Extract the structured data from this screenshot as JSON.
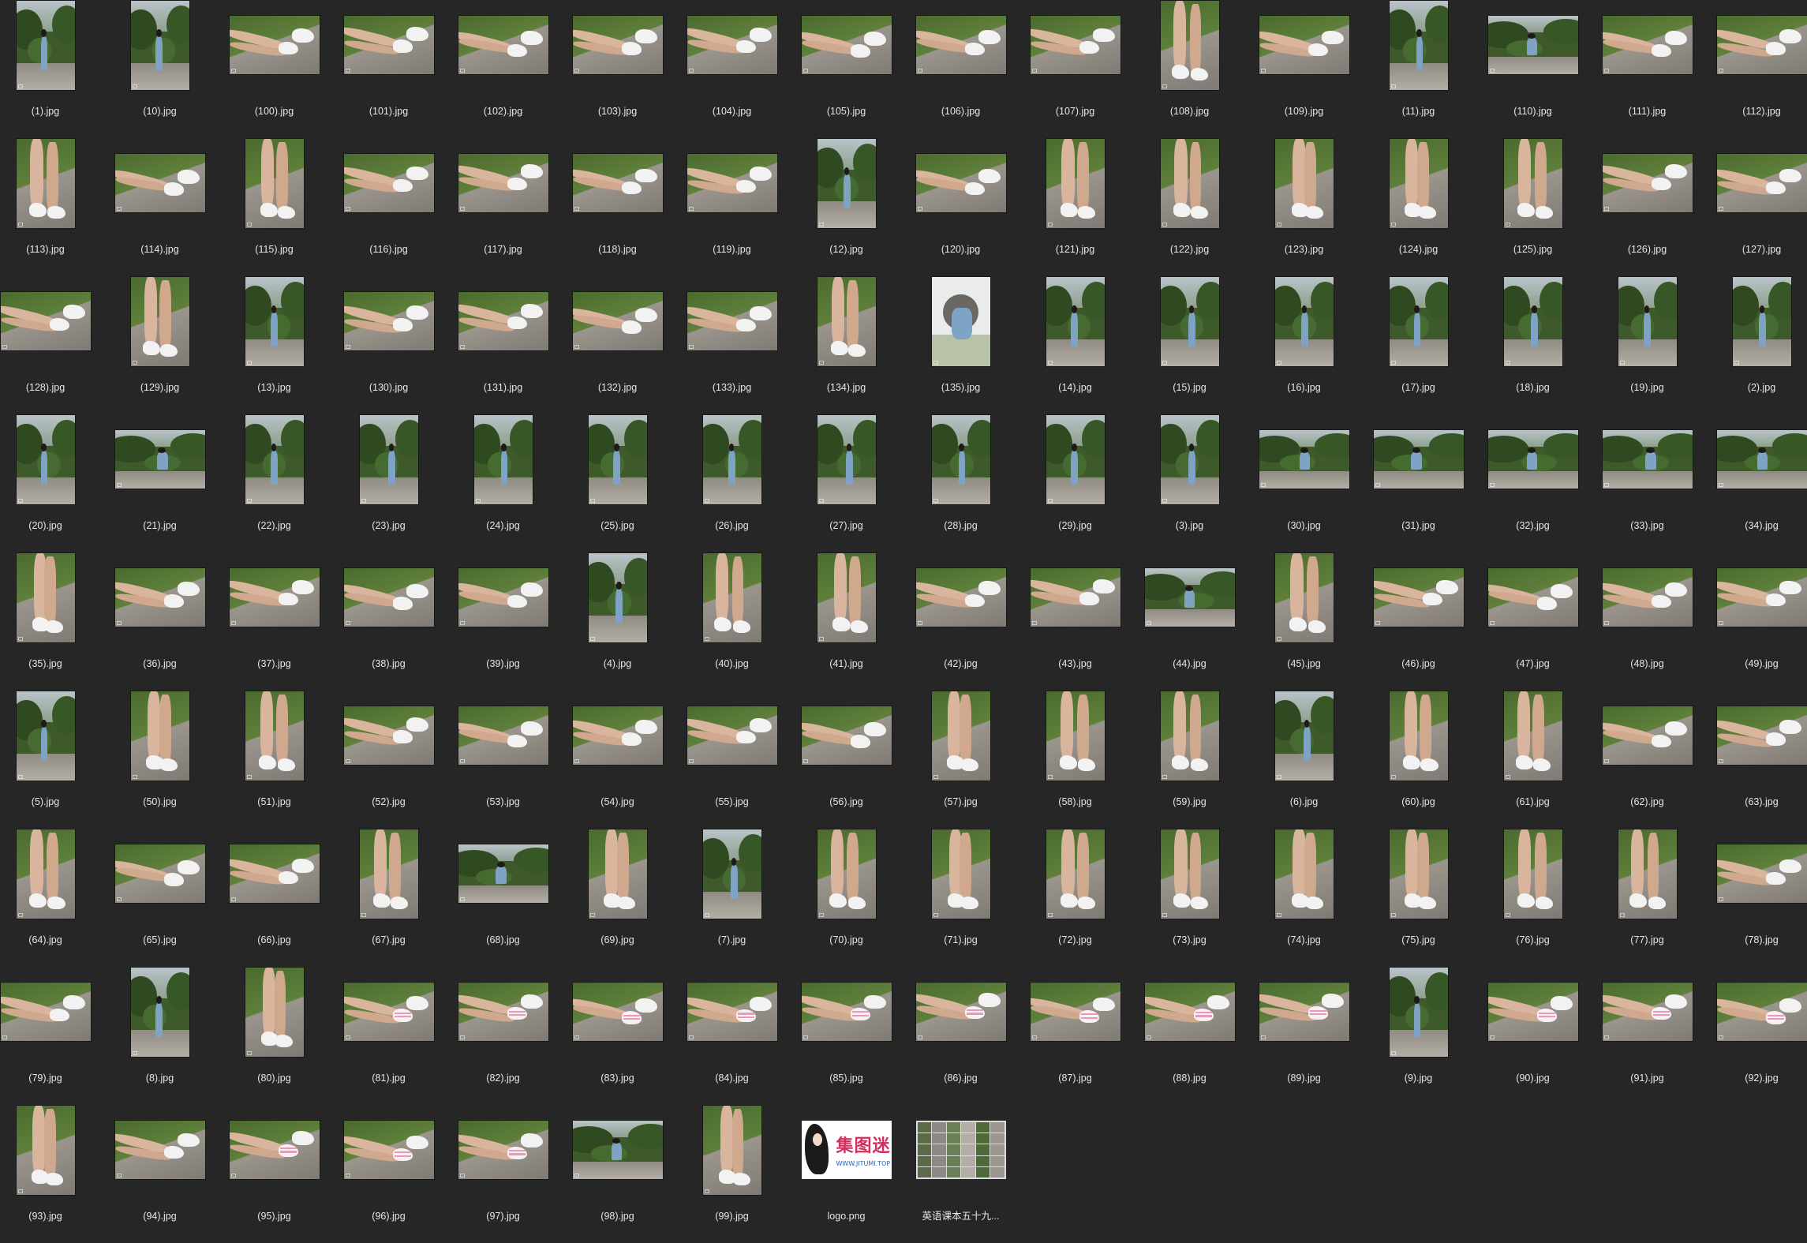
{
  "window": {
    "title": ""
  },
  "files": [
    {
      "name": "(1).jpg",
      "kind": "portrait",
      "scene": "wide"
    },
    {
      "name": "(10).jpg",
      "kind": "portrait",
      "scene": "wide"
    },
    {
      "name": "(100).jpg",
      "kind": "landscape",
      "scene": "feet"
    },
    {
      "name": "(101).jpg",
      "kind": "landscape",
      "scene": "feet"
    },
    {
      "name": "(102).jpg",
      "kind": "landscape",
      "scene": "feet"
    },
    {
      "name": "(103).jpg",
      "kind": "landscape",
      "scene": "feet"
    },
    {
      "name": "(104).jpg",
      "kind": "landscape",
      "scene": "feet"
    },
    {
      "name": "(105).jpg",
      "kind": "landscape",
      "scene": "feet"
    },
    {
      "name": "(106).jpg",
      "kind": "landscape",
      "scene": "feet"
    },
    {
      "name": "(107).jpg",
      "kind": "landscape",
      "scene": "feet"
    },
    {
      "name": "(108).jpg",
      "kind": "portrait",
      "scene": "legs"
    },
    {
      "name": "(109).jpg",
      "kind": "landscape",
      "scene": "feet"
    },
    {
      "name": "(11).jpg",
      "kind": "portrait",
      "scene": "wide"
    },
    {
      "name": "(110).jpg",
      "kind": "landscape",
      "scene": "sitting"
    },
    {
      "name": "(111).jpg",
      "kind": "landscape",
      "scene": "feet"
    },
    {
      "name": "(112).jpg",
      "kind": "landscape",
      "scene": "feet"
    },
    {
      "name": "(113).jpg",
      "kind": "portrait",
      "scene": "legs"
    },
    {
      "name": "(114).jpg",
      "kind": "landscape",
      "scene": "feet"
    },
    {
      "name": "(115).jpg",
      "kind": "portrait",
      "scene": "legs"
    },
    {
      "name": "(116).jpg",
      "kind": "landscape",
      "scene": "feet"
    },
    {
      "name": "(117).jpg",
      "kind": "landscape",
      "scene": "feet"
    },
    {
      "name": "(118).jpg",
      "kind": "landscape",
      "scene": "feet"
    },
    {
      "name": "(119).jpg",
      "kind": "landscape",
      "scene": "feet"
    },
    {
      "name": "(12).jpg",
      "kind": "portrait",
      "scene": "wide"
    },
    {
      "name": "(120).jpg",
      "kind": "landscape",
      "scene": "feet"
    },
    {
      "name": "(121).jpg",
      "kind": "portrait",
      "scene": "legs"
    },
    {
      "name": "(122).jpg",
      "kind": "portrait",
      "scene": "legs"
    },
    {
      "name": "(123).jpg",
      "kind": "portrait",
      "scene": "legs"
    },
    {
      "name": "(124).jpg",
      "kind": "portrait",
      "scene": "legs"
    },
    {
      "name": "(125).jpg",
      "kind": "portrait",
      "scene": "legs"
    },
    {
      "name": "(126).jpg",
      "kind": "landscape",
      "scene": "feet"
    },
    {
      "name": "(127).jpg",
      "kind": "landscape",
      "scene": "feet"
    },
    {
      "name": "(128).jpg",
      "kind": "landscape",
      "scene": "feet"
    },
    {
      "name": "(129).jpg",
      "kind": "portrait",
      "scene": "legs"
    },
    {
      "name": "(13).jpg",
      "kind": "portrait",
      "scene": "wide"
    },
    {
      "name": "(130).jpg",
      "kind": "landscape",
      "scene": "feet"
    },
    {
      "name": "(131).jpg",
      "kind": "landscape",
      "scene": "feet"
    },
    {
      "name": "(132).jpg",
      "kind": "landscape",
      "scene": "feet"
    },
    {
      "name": "(133).jpg",
      "kind": "landscape",
      "scene": "feet"
    },
    {
      "name": "(134).jpg",
      "kind": "portrait",
      "scene": "legs"
    },
    {
      "name": "(135).jpg",
      "kind": "portrait",
      "scene": "bright"
    },
    {
      "name": "(14).jpg",
      "kind": "portrait",
      "scene": "wide"
    },
    {
      "name": "(15).jpg",
      "kind": "portrait",
      "scene": "wide"
    },
    {
      "name": "(16).jpg",
      "kind": "portrait",
      "scene": "wide"
    },
    {
      "name": "(17).jpg",
      "kind": "portrait",
      "scene": "wide"
    },
    {
      "name": "(18).jpg",
      "kind": "portrait",
      "scene": "wide"
    },
    {
      "name": "(19).jpg",
      "kind": "portrait",
      "scene": "wide"
    },
    {
      "name": "(2).jpg",
      "kind": "portrait",
      "scene": "wide"
    },
    {
      "name": "(20).jpg",
      "kind": "portrait",
      "scene": "wide"
    },
    {
      "name": "(21).jpg",
      "kind": "landscape",
      "scene": "sitting"
    },
    {
      "name": "(22).jpg",
      "kind": "portrait",
      "scene": "wide"
    },
    {
      "name": "(23).jpg",
      "kind": "portrait",
      "scene": "wide"
    },
    {
      "name": "(24).jpg",
      "kind": "portrait",
      "scene": "wide"
    },
    {
      "name": "(25).jpg",
      "kind": "portrait",
      "scene": "wide"
    },
    {
      "name": "(26).jpg",
      "kind": "portrait",
      "scene": "wide"
    },
    {
      "name": "(27).jpg",
      "kind": "portrait",
      "scene": "wide"
    },
    {
      "name": "(28).jpg",
      "kind": "portrait",
      "scene": "wide"
    },
    {
      "name": "(29).jpg",
      "kind": "portrait",
      "scene": "wide"
    },
    {
      "name": "(3).jpg",
      "kind": "portrait",
      "scene": "wide"
    },
    {
      "name": "(30).jpg",
      "kind": "landscape",
      "scene": "sitting"
    },
    {
      "name": "(31).jpg",
      "kind": "landscape",
      "scene": "sitting"
    },
    {
      "name": "(32).jpg",
      "kind": "landscape",
      "scene": "sitting"
    },
    {
      "name": "(33).jpg",
      "kind": "landscape",
      "scene": "sitting"
    },
    {
      "name": "(34).jpg",
      "kind": "landscape",
      "scene": "sitting"
    },
    {
      "name": "(35).jpg",
      "kind": "portrait",
      "scene": "legs"
    },
    {
      "name": "(36).jpg",
      "kind": "landscape",
      "scene": "feet"
    },
    {
      "name": "(37).jpg",
      "kind": "landscape",
      "scene": "feet"
    },
    {
      "name": "(38).jpg",
      "kind": "landscape",
      "scene": "feet"
    },
    {
      "name": "(39).jpg",
      "kind": "landscape",
      "scene": "feet"
    },
    {
      "name": "(4).jpg",
      "kind": "portrait",
      "scene": "wide"
    },
    {
      "name": "(40).jpg",
      "kind": "portrait",
      "scene": "legs"
    },
    {
      "name": "(41).jpg",
      "kind": "portrait",
      "scene": "legs"
    },
    {
      "name": "(42).jpg",
      "kind": "landscape",
      "scene": "feet"
    },
    {
      "name": "(43).jpg",
      "kind": "landscape",
      "scene": "feet"
    },
    {
      "name": "(44).jpg",
      "kind": "landscape",
      "scene": "sitting"
    },
    {
      "name": "(45).jpg",
      "kind": "portrait",
      "scene": "legs"
    },
    {
      "name": "(46).jpg",
      "kind": "landscape",
      "scene": "feet"
    },
    {
      "name": "(47).jpg",
      "kind": "landscape",
      "scene": "feet"
    },
    {
      "name": "(48).jpg",
      "kind": "landscape",
      "scene": "feet"
    },
    {
      "name": "(49).jpg",
      "kind": "landscape",
      "scene": "feet"
    },
    {
      "name": "(5).jpg",
      "kind": "portrait",
      "scene": "wide"
    },
    {
      "name": "(50).jpg",
      "kind": "portrait",
      "scene": "legs"
    },
    {
      "name": "(51).jpg",
      "kind": "portrait",
      "scene": "legs"
    },
    {
      "name": "(52).jpg",
      "kind": "landscape",
      "scene": "feet"
    },
    {
      "name": "(53).jpg",
      "kind": "landscape",
      "scene": "feet"
    },
    {
      "name": "(54).jpg",
      "kind": "landscape",
      "scene": "feet"
    },
    {
      "name": "(55).jpg",
      "kind": "landscape",
      "scene": "feet"
    },
    {
      "name": "(56).jpg",
      "kind": "landscape",
      "scene": "feet"
    },
    {
      "name": "(57).jpg",
      "kind": "portrait",
      "scene": "legs"
    },
    {
      "name": "(58).jpg",
      "kind": "portrait",
      "scene": "legs"
    },
    {
      "name": "(59).jpg",
      "kind": "portrait",
      "scene": "legs"
    },
    {
      "name": "(6).jpg",
      "kind": "portrait",
      "scene": "wide"
    },
    {
      "name": "(60).jpg",
      "kind": "portrait",
      "scene": "legs"
    },
    {
      "name": "(61).jpg",
      "kind": "portrait",
      "scene": "legs"
    },
    {
      "name": "(62).jpg",
      "kind": "landscape",
      "scene": "feet"
    },
    {
      "name": "(63).jpg",
      "kind": "landscape",
      "scene": "feet"
    },
    {
      "name": "(64).jpg",
      "kind": "portrait",
      "scene": "legs"
    },
    {
      "name": "(65).jpg",
      "kind": "landscape",
      "scene": "feet"
    },
    {
      "name": "(66).jpg",
      "kind": "landscape",
      "scene": "feet"
    },
    {
      "name": "(67).jpg",
      "kind": "portrait",
      "scene": "legs"
    },
    {
      "name": "(68).jpg",
      "kind": "landscape",
      "scene": "sitting"
    },
    {
      "name": "(69).jpg",
      "kind": "portrait",
      "scene": "legs"
    },
    {
      "name": "(7).jpg",
      "kind": "portrait",
      "scene": "wide"
    },
    {
      "name": "(70).jpg",
      "kind": "portrait",
      "scene": "legs"
    },
    {
      "name": "(71).jpg",
      "kind": "portrait",
      "scene": "legs"
    },
    {
      "name": "(72).jpg",
      "kind": "portrait",
      "scene": "legs"
    },
    {
      "name": "(73).jpg",
      "kind": "portrait",
      "scene": "legs"
    },
    {
      "name": "(74).jpg",
      "kind": "portrait",
      "scene": "legs"
    },
    {
      "name": "(75).jpg",
      "kind": "portrait",
      "scene": "legs"
    },
    {
      "name": "(76).jpg",
      "kind": "portrait",
      "scene": "legs"
    },
    {
      "name": "(77).jpg",
      "kind": "portrait",
      "scene": "legs"
    },
    {
      "name": "(78).jpg",
      "kind": "landscape",
      "scene": "feet"
    },
    {
      "name": "(79).jpg",
      "kind": "landscape",
      "scene": "feet"
    },
    {
      "name": "(8).jpg",
      "kind": "portrait",
      "scene": "wide"
    },
    {
      "name": "(80).jpg",
      "kind": "portrait",
      "scene": "legs"
    },
    {
      "name": "(81).jpg",
      "kind": "landscape",
      "scene": "socks"
    },
    {
      "name": "(82).jpg",
      "kind": "landscape",
      "scene": "socks"
    },
    {
      "name": "(83).jpg",
      "kind": "landscape",
      "scene": "socks"
    },
    {
      "name": "(84).jpg",
      "kind": "landscape",
      "scene": "socks"
    },
    {
      "name": "(85).jpg",
      "kind": "landscape",
      "scene": "socks"
    },
    {
      "name": "(86).jpg",
      "kind": "landscape",
      "scene": "socks"
    },
    {
      "name": "(87).jpg",
      "kind": "landscape",
      "scene": "socks"
    },
    {
      "name": "(88).jpg",
      "kind": "landscape",
      "scene": "socks"
    },
    {
      "name": "(89).jpg",
      "kind": "landscape",
      "scene": "socks"
    },
    {
      "name": "(9).jpg",
      "kind": "portrait",
      "scene": "wide"
    },
    {
      "name": "(90).jpg",
      "kind": "landscape",
      "scene": "socks"
    },
    {
      "name": "(91).jpg",
      "kind": "landscape",
      "scene": "socks"
    },
    {
      "name": "(92).jpg",
      "kind": "landscape",
      "scene": "socks"
    },
    {
      "name": "(93).jpg",
      "kind": "portrait",
      "scene": "legs"
    },
    {
      "name": "(94).jpg",
      "kind": "landscape",
      "scene": "feet"
    },
    {
      "name": "(95).jpg",
      "kind": "landscape",
      "scene": "socks"
    },
    {
      "name": "(96).jpg",
      "kind": "landscape",
      "scene": "socks"
    },
    {
      "name": "(97).jpg",
      "kind": "landscape",
      "scene": "socks"
    },
    {
      "name": "(98).jpg",
      "kind": "landscape",
      "scene": "sitting"
    },
    {
      "name": "(99).jpg",
      "kind": "portrait",
      "scene": "legs"
    },
    {
      "name": "logo.png",
      "kind": "logo",
      "scene": "logo",
      "logo_text": "集图迷",
      "logo_url": "WWW.JITUMI.TOP"
    },
    {
      "name": "英语课本五十九...",
      "kind": "sheet",
      "scene": "sheet"
    }
  ],
  "colors": {
    "background": "#262626",
    "label": "#e6e6e6",
    "grass": "#4a6b2e",
    "stone": "#9a958d",
    "skin": "#d8b59c",
    "denim": "#7fa3c4",
    "sock_stripe": "#e79ab9",
    "logo_brand": "#d32f5c",
    "logo_url": "#2a63b8"
  }
}
